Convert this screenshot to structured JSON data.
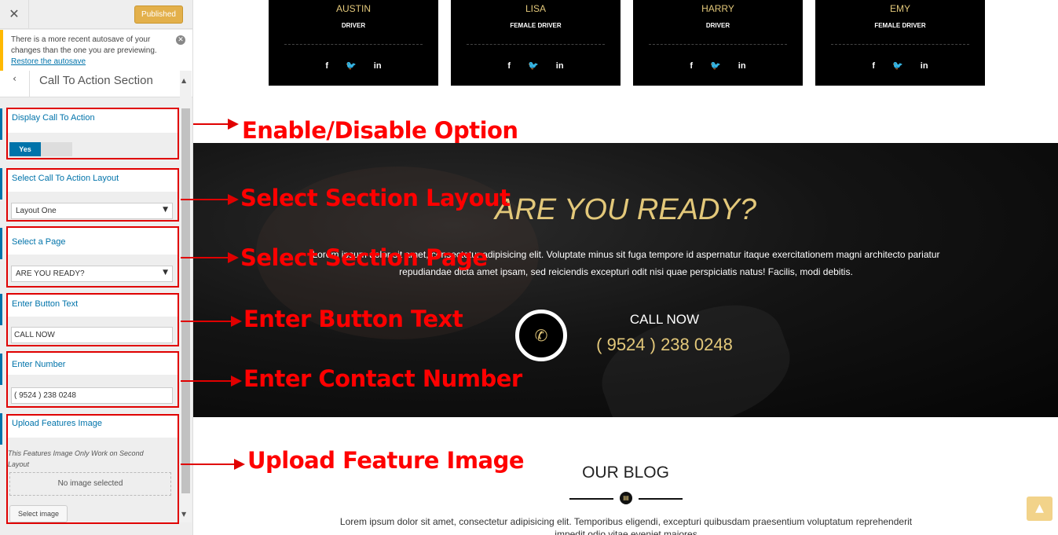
{
  "sidebar": {
    "close_icon": "close-icon",
    "published_label": "Published",
    "notice": {
      "text": "There is a more recent autosave of your changes than the one you are previewing.",
      "link": "Restore the autosave"
    },
    "section_title": "Call To Action Section",
    "controls": {
      "display_cta": {
        "label": "Display Call To Action",
        "toggle_value": "Yes"
      },
      "layout": {
        "label": "Select Call To Action Layout",
        "value": "Layout One"
      },
      "page": {
        "label": "Select a Page",
        "value": "ARE YOU READY?"
      },
      "button_text": {
        "label": "Enter Button Text",
        "value": "CALL NOW"
      },
      "number": {
        "label": "Enter Number",
        "value": "( 9524 ) 238 0248"
      },
      "feature_image": {
        "label": "Upload Features Image",
        "description": "This Features Image Only Work on Second Layout",
        "empty_text": "No image selected",
        "button_label": "Select image"
      }
    }
  },
  "team": [
    {
      "name": "AUSTIN",
      "role": "DRIVER"
    },
    {
      "name": "LISA",
      "role": "FEMALE DRIVER"
    },
    {
      "name": "HARRY",
      "role": "DRIVER"
    },
    {
      "name": "EMY",
      "role": "FEMALE DRIVER"
    }
  ],
  "social_icons": [
    "facebook-icon",
    "twitter-icon",
    "linkedin-icon"
  ],
  "cta": {
    "title": "ARE YOU READY?",
    "body": "Lorem ipsum dolor sit amet, consectetur adipisicing elit. Voluptate minus sit fuga tempore id aspernatur itaque exercitationem magni architecto pariatur repudiandae dicta amet ipsam, sed reiciendis excepturi odit nisi quae perspiciatis natus! Facilis, modi debitis.",
    "call_label": "CALL NOW",
    "call_number": "( 9524 ) 238 0248"
  },
  "blog": {
    "title": "OUR BLOG",
    "text": "Lorem ipsum dolor sit amet, consectetur adipisicing elit. Temporibus eligendi, excepturi quibusdam praesentium voluptatum reprehenderit impedit odio vitae eveniet maiores"
  },
  "annotations": {
    "enable": "Enable/Disable Option",
    "layout": "Select Section Layout",
    "page": "Select Section Page",
    "button": "Enter Button Text",
    "number": "Enter Contact Number",
    "image": "Upload Feature Image"
  },
  "colors": {
    "accent": "#0073aa",
    "gold": "#e3c87a",
    "annotation_red": "#e00000",
    "published": "#e3b04b"
  }
}
